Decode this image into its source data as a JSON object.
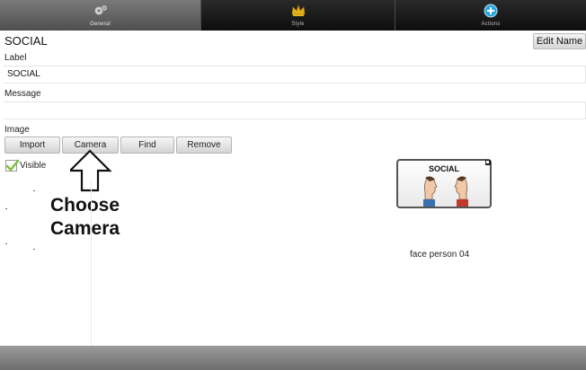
{
  "tabs": [
    {
      "label": "General",
      "icon": "gears-icon"
    },
    {
      "label": "Style",
      "icon": "crown-icon"
    },
    {
      "label": "Actions",
      "icon": "plus-circle-icon"
    }
  ],
  "header": {
    "title": "SOCIAL",
    "edit_name_label": "Edit Name"
  },
  "form": {
    "label_heading": "Label",
    "label_value": "SOCIAL",
    "message_heading": "Message",
    "message_value": "",
    "image_heading": "Image",
    "image_buttons": [
      "Import",
      "Camera",
      "Find",
      "Remove"
    ],
    "visible_label": "Visible",
    "visible_checked": true
  },
  "callout": {
    "line1": "Choose",
    "line2": "Camera"
  },
  "symbol": {
    "tile_label": "SOCIAL",
    "image_name": "face person 04"
  },
  "colors": {
    "accent_actions": "#2aa6e0",
    "checkmark": "#7cc242",
    "style_icon": "#e3b21c"
  }
}
